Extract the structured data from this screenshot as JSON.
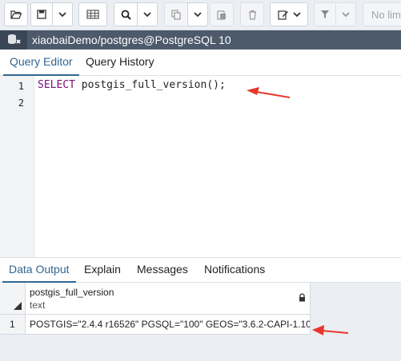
{
  "toolbar": {
    "limit_label": "No lim",
    "buttons": [
      {
        "name": "open-file",
        "icon": "folder-open-icon"
      },
      {
        "name": "save",
        "icon": "save-icon"
      },
      {
        "name": "save-dropdown",
        "icon": "chevron-down-icon"
      },
      {
        "name": "find",
        "icon": "search-icon"
      },
      {
        "name": "find-dropdown",
        "icon": "chevron-down-icon"
      },
      {
        "name": "copy",
        "icon": "copy-icon"
      },
      {
        "name": "copy-dropdown",
        "icon": "chevron-down-icon"
      },
      {
        "name": "paste",
        "icon": "paste-icon"
      },
      {
        "name": "delete",
        "icon": "trash-icon"
      },
      {
        "name": "edit",
        "icon": "edit-icon"
      },
      {
        "name": "filter",
        "icon": "filter-icon"
      },
      {
        "name": "filter-dropdown",
        "icon": "chevron-down-icon"
      }
    ]
  },
  "connection": {
    "label": "xiaobaiDemo/postgres@PostgreSQL 10",
    "icon": "database-icon"
  },
  "editor_tabs": [
    {
      "label": "Query Editor",
      "active": true
    },
    {
      "label": "Query History",
      "active": false
    }
  ],
  "editor": {
    "line_numbers": [
      "1",
      "2"
    ],
    "keyword": "SELECT",
    "code_rest": " postgis_full_version();"
  },
  "result_tabs": [
    {
      "label": "Data Output",
      "active": true
    },
    {
      "label": "Explain",
      "active": false
    },
    {
      "label": "Messages",
      "active": false
    },
    {
      "label": "Notifications",
      "active": false
    }
  ],
  "grid": {
    "column_name": "postgis_full_version",
    "column_type": "text",
    "rows": [
      {
        "num": "1",
        "value": "POSTGIS=\"2.4.4 r16526\" PGSQL=\"100\" GEOS=\"3.6.2-CAPI-1.10...."
      }
    ]
  },
  "colors": {
    "accent": "#326690",
    "connection_bar": "#4c5a6b",
    "keyword": "#7a0e7a",
    "annotation_arrow": "#e8372c"
  }
}
